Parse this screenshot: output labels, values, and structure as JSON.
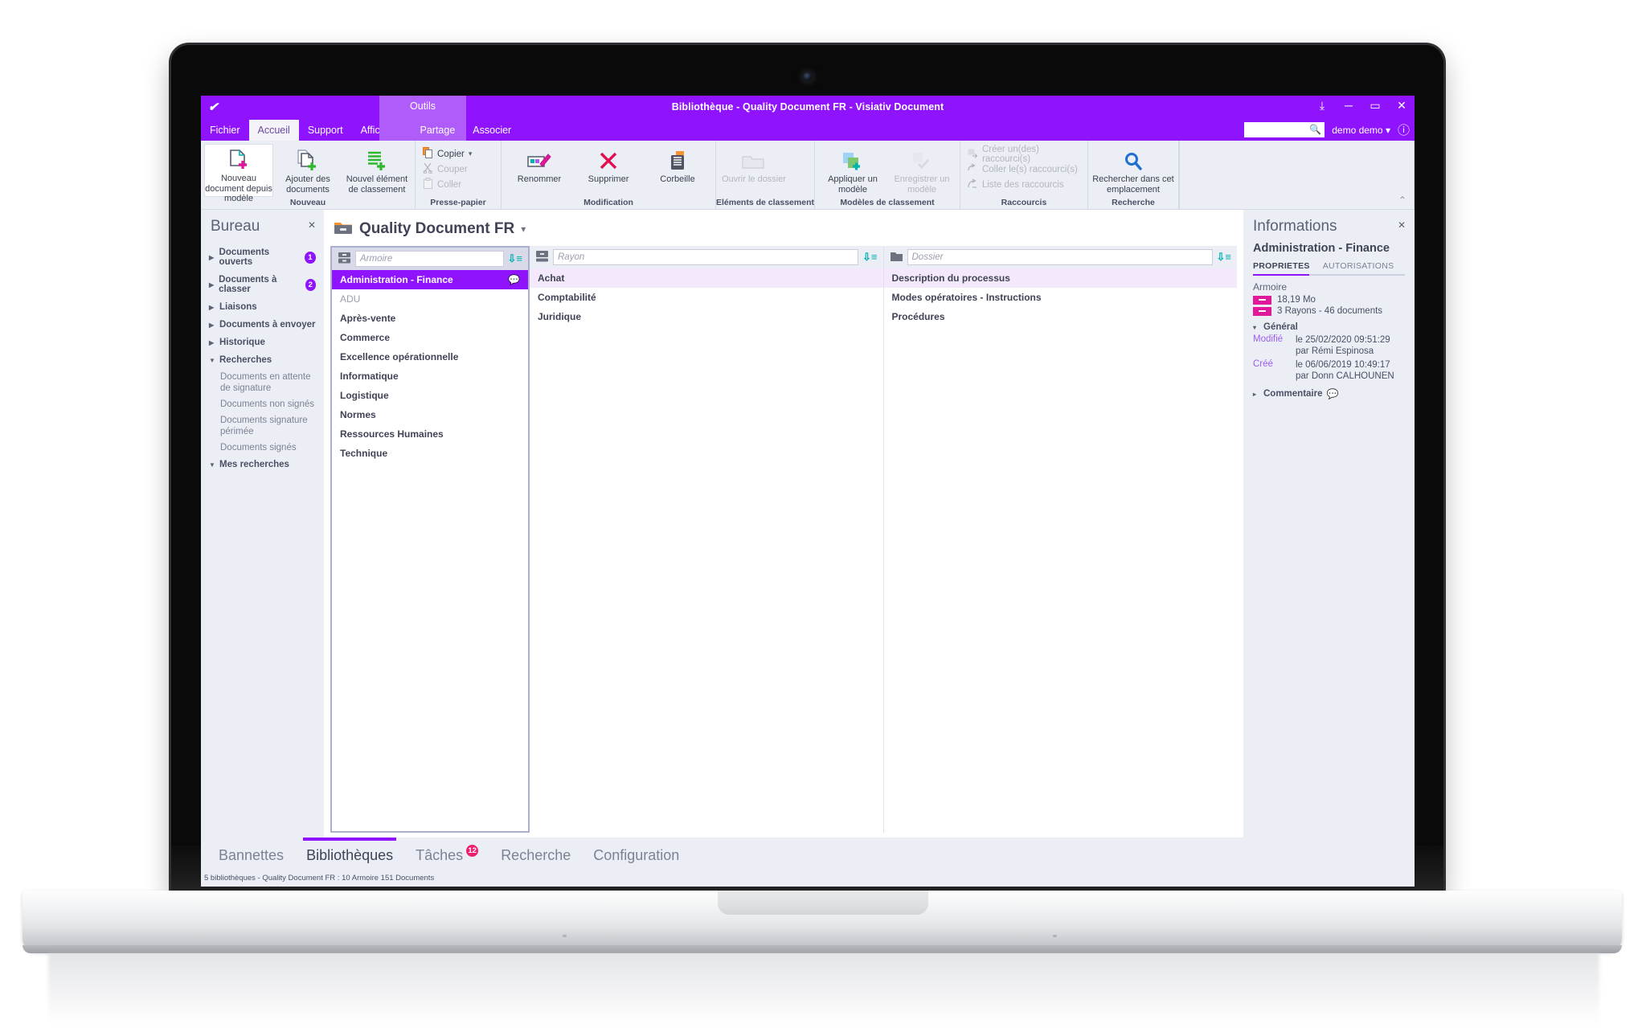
{
  "window": {
    "title": "Bibliothèque - Quality Document FR - Visiativ Document",
    "logo_icon": "visiativ-logo-icon",
    "restore_icon": "restore-down-icon",
    "minimize_icon": "minimize-icon",
    "maximize_icon": "maximize-icon",
    "close_icon": "close-icon",
    "contextual_group": "Outils"
  },
  "topsearch": {
    "value": "",
    "placeholder": "",
    "icon": "search-icon"
  },
  "user": {
    "name": "demo demo",
    "caret": "▾",
    "help_icon": "help-icon"
  },
  "ribbon_tabs": [
    {
      "label": "Fichier",
      "active": false,
      "contextual": false
    },
    {
      "label": "Accueil",
      "active": true,
      "contextual": false
    },
    {
      "label": "Support",
      "active": false,
      "contextual": false
    },
    {
      "label": "Affichage",
      "active": false,
      "contextual": false
    },
    {
      "label": "Partage",
      "active": false,
      "contextual": true
    },
    {
      "label": "Associer",
      "active": false,
      "contextual": true
    }
  ],
  "ribbon": {
    "collapse_icon": "chevron-up-icon",
    "groups": [
      {
        "title": "Nouveau",
        "buttons": [
          {
            "label": "Nouveau document depuis modèle",
            "icon": "new-document-from-template-icon",
            "active": true,
            "disabled": false
          },
          {
            "label": "Ajouter des documents",
            "icon": "add-documents-icon",
            "active": false,
            "disabled": false
          },
          {
            "label": "Nouvel élément de classement",
            "icon": "new-filing-element-icon",
            "active": false,
            "disabled": false
          }
        ]
      },
      {
        "title": "Presse-papier",
        "small_buttons": [
          {
            "label": "Copier",
            "icon": "copy-icon",
            "disabled": false,
            "has_caret": true
          },
          {
            "label": "Couper",
            "icon": "cut-icon",
            "disabled": true,
            "has_caret": false
          },
          {
            "label": "Coller",
            "icon": "paste-icon",
            "disabled": true,
            "has_caret": false
          }
        ]
      },
      {
        "title": "Modification",
        "buttons": [
          {
            "label": "Renommer",
            "icon": "rename-icon",
            "active": false,
            "disabled": false
          },
          {
            "label": "Supprimer",
            "icon": "delete-icon",
            "active": false,
            "disabled": false
          },
          {
            "label": "Corbeille",
            "icon": "trash-icon",
            "active": false,
            "disabled": false
          }
        ]
      },
      {
        "title": "Eléments de classement",
        "buttons": [
          {
            "label": "Ouvrir le dossier",
            "icon": "open-folder-icon",
            "active": false,
            "disabled": true
          }
        ]
      },
      {
        "title": "Modèles de classement",
        "buttons": [
          {
            "label": "Appliquer un modèle",
            "icon": "apply-template-icon",
            "active": false,
            "disabled": false
          },
          {
            "label": "Enregistrer un modèle",
            "icon": "save-template-icon",
            "active": false,
            "disabled": true
          }
        ]
      },
      {
        "title": "Raccourcis",
        "small_buttons": [
          {
            "label": "Créer un(des) raccourci(s)",
            "icon": "create-shortcut-icon",
            "disabled": true,
            "has_caret": false
          },
          {
            "label": "Coller le(s) raccourci(s)",
            "icon": "paste-shortcut-icon",
            "disabled": true,
            "has_caret": false
          },
          {
            "label": "Liste des raccourcis",
            "icon": "shortcut-list-icon",
            "disabled": true,
            "has_caret": false
          }
        ]
      },
      {
        "title": "Recherche",
        "buttons": [
          {
            "label": "Rechercher dans cet emplacement",
            "icon": "search-location-icon",
            "active": false,
            "disabled": false
          }
        ]
      }
    ]
  },
  "sidebar": {
    "title": "Bureau",
    "close_icon": "close-icon",
    "items": [
      {
        "label": "Documents ouverts",
        "badge": "1",
        "expanded": false,
        "child": false
      },
      {
        "label": "Documents à classer",
        "badge": "2",
        "expanded": false,
        "child": false
      },
      {
        "label": "Liaisons",
        "badge": "",
        "expanded": false,
        "child": false
      },
      {
        "label": "Documents à envoyer",
        "badge": "",
        "expanded": false,
        "child": false
      },
      {
        "label": "Historique",
        "badge": "",
        "expanded": false,
        "child": false
      },
      {
        "label": "Recherches",
        "badge": "",
        "expanded": true,
        "child": false
      },
      {
        "label": "Documents en attente de signature",
        "badge": "",
        "expanded": false,
        "child": true
      },
      {
        "label": "Documents non signés",
        "badge": "",
        "expanded": false,
        "child": true
      },
      {
        "label": "Documents signature périmée",
        "badge": "",
        "expanded": false,
        "child": true
      },
      {
        "label": "Documents signés",
        "badge": "",
        "expanded": false,
        "child": true
      },
      {
        "label": "Mes recherches",
        "badge": "",
        "expanded": true,
        "child": false
      }
    ]
  },
  "breadcrumb": {
    "icon": "library-cabinet-icon",
    "title": "Quality Document FR",
    "caret": "▾"
  },
  "columns": [
    {
      "name": "armoire",
      "filter_placeholder": "Armoire",
      "filter_value": "",
      "filter_icon": "cabinet-icon",
      "sort_icon": "sort-descending-icon",
      "items": [
        {
          "label": "Administration - Finance",
          "state": "selected-strong",
          "badge_icon": "comment-icon"
        },
        {
          "label": "ADU",
          "state": "muted",
          "badge_icon": ""
        },
        {
          "label": "Après-vente",
          "state": "normal",
          "badge_icon": ""
        },
        {
          "label": "Commerce",
          "state": "normal",
          "badge_icon": ""
        },
        {
          "label": "Excellence opérationnelle",
          "state": "normal",
          "badge_icon": ""
        },
        {
          "label": "Informatique",
          "state": "normal",
          "badge_icon": ""
        },
        {
          "label": "Logistique",
          "state": "normal",
          "badge_icon": ""
        },
        {
          "label": "Normes",
          "state": "normal",
          "badge_icon": ""
        },
        {
          "label": "Ressources Humaines",
          "state": "normal",
          "badge_icon": ""
        },
        {
          "label": "Technique",
          "state": "normal",
          "badge_icon": ""
        }
      ]
    },
    {
      "name": "rayon",
      "filter_placeholder": "Rayon",
      "filter_value": "",
      "filter_icon": "shelf-icon",
      "sort_icon": "sort-descending-icon",
      "items": [
        {
          "label": "Achat",
          "state": "selected-light",
          "badge_icon": ""
        },
        {
          "label": "Comptabilité",
          "state": "normal",
          "badge_icon": ""
        },
        {
          "label": "Juridique",
          "state": "normal",
          "badge_icon": ""
        }
      ]
    },
    {
      "name": "dossier",
      "filter_placeholder": "Dossier",
      "filter_value": "",
      "filter_icon": "folder-icon",
      "sort_icon": "sort-descending-icon",
      "items": [
        {
          "label": "Description du processus",
          "state": "selected-light",
          "badge_icon": ""
        },
        {
          "label": "Modes opératoires - Instructions",
          "state": "normal",
          "badge_icon": ""
        },
        {
          "label": "Procédures",
          "state": "normal",
          "badge_icon": ""
        }
      ]
    }
  ],
  "info": {
    "title": "Informations",
    "close_icon": "close-icon",
    "subject": "Administration - Finance",
    "tabs": [
      {
        "label": "PROPRIETES",
        "active": true
      },
      {
        "label": "AUTORISATIONS",
        "active": false
      }
    ],
    "kind": "Armoire",
    "stats": [
      {
        "value": "18,19 Mo"
      },
      {
        "value": "3 Rayons - 46 documents"
      }
    ],
    "general": {
      "header": "Général",
      "caret": "▾",
      "rows": [
        {
          "key": "Modifié",
          "value": "le 25/02/2020 09:51:29 par Rémi Espinosa"
        },
        {
          "key": "Créé",
          "value": "le 06/06/2019 10:49:17 par Donn CALHOUNEN"
        }
      ]
    },
    "comment": {
      "label": "Commentaire",
      "caret": "▸",
      "icon": "comment-icon"
    }
  },
  "bottom_tabs": [
    {
      "label": "Bannettes",
      "active": false,
      "badge": ""
    },
    {
      "label": "Bibliothèques",
      "active": true,
      "badge": ""
    },
    {
      "label": "Tâches",
      "active": false,
      "badge": "12"
    },
    {
      "label": "Recherche",
      "active": false,
      "badge": ""
    },
    {
      "label": "Configuration",
      "active": false,
      "badge": ""
    }
  ],
  "statusbar": {
    "text": "5 bibliothèques - Quality Document FR : 10 Armoire 151 Documents"
  },
  "colors": {
    "brand_purple": "#9013fe",
    "contextual_purple": "#b05cfb",
    "panel_bg": "#eceef6",
    "badge_pink": "#ee1f6e",
    "stat_magenta": "#e0189a",
    "sort_teal": "#00b3b0"
  }
}
